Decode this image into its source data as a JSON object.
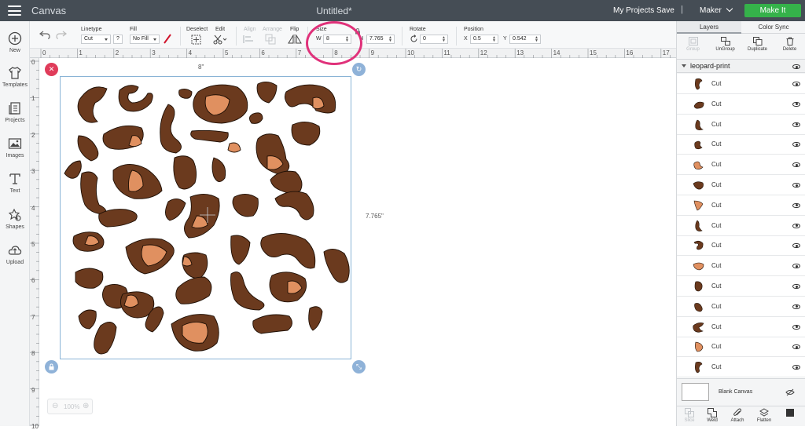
{
  "topbar": {
    "app_title": "Canvas",
    "document_title": "Untitled*",
    "my_projects": "My Projects",
    "save": "Save",
    "separator": "|",
    "machine": "Maker",
    "make_it": "Make It"
  },
  "leftbar": [
    {
      "label": "New",
      "icon": "plus-circle-icon"
    },
    {
      "label": "Templates",
      "icon": "shirt-icon"
    },
    {
      "label": "Projects",
      "icon": "projects-icon"
    },
    {
      "label": "Images",
      "icon": "image-icon"
    },
    {
      "label": "Text",
      "icon": "text-icon"
    },
    {
      "label": "Shapes",
      "icon": "shapes-icon"
    },
    {
      "label": "Upload",
      "icon": "upload-cloud-icon"
    }
  ],
  "toolbar": {
    "linetype_label": "Linetype",
    "linetype_value": "Cut",
    "help": "?",
    "fill_label": "Fill",
    "fill_value": "No Fill",
    "deselect_label": "Deselect",
    "edit_label": "Edit",
    "align_label": "Align",
    "arrange_label": "Arrange",
    "flip_label": "Flip",
    "size_label": "Size",
    "width_prefix": "W",
    "width_value": "8",
    "height_prefix": "H",
    "height_value": "7.765",
    "rotate_label": "Rotate",
    "rotate_value": "0",
    "position_label": "Position",
    "x_prefix": "X",
    "x_value": "0.5",
    "y_prefix": "Y",
    "y_value": "0.542"
  },
  "ruler": {
    "top": [
      "0",
      "1",
      "2",
      "3",
      "4",
      "5",
      "6",
      "7",
      "8",
      "9",
      "10",
      "11",
      "12",
      "13",
      "14",
      "15",
      "16",
      "17"
    ],
    "left": [
      "0",
      "1",
      "2",
      "3",
      "4",
      "5",
      "6",
      "7",
      "8",
      "9",
      "10"
    ]
  },
  "canvas": {
    "width_dimension": "8\"",
    "height_dimension": "7.765\"",
    "zoom": "100%",
    "selection_color": "#8ab4d6",
    "delete_handle_color": "#e03c5a",
    "handle_color": "#8fb2d8",
    "dark_spot_color": "#6b3a1e",
    "light_spot_color": "#e09060"
  },
  "annotation": {
    "color": "#e0317a"
  },
  "rightpanel": {
    "tab_layers": "Layers",
    "tab_color_sync": "Color Sync",
    "group": "Group",
    "ungroup": "UnGroup",
    "duplicate": "Duplicate",
    "delete": "Delete",
    "group_name": "leopard-print",
    "layers": [
      "Cut",
      "Cut",
      "Cut",
      "Cut",
      "Cut",
      "Cut",
      "Cut",
      "Cut",
      "Cut",
      "Cut",
      "Cut",
      "Cut",
      "Cut",
      "Cut",
      "Cut"
    ],
    "blank_canvas": "Blank Canvas",
    "bottom_actions": [
      "Slice",
      "Weld",
      "Attach",
      "Flatten",
      ""
    ]
  }
}
